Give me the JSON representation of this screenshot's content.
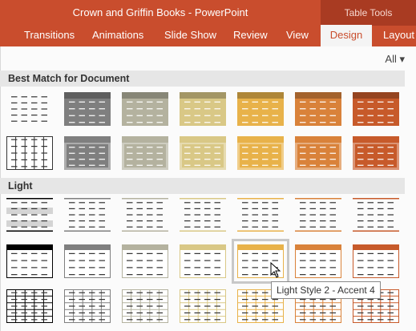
{
  "window": {
    "title": "Crown and Griffin Books - PowerPoint",
    "context_label": "Table Tools"
  },
  "tabs": [
    {
      "label": "Transitions"
    },
    {
      "label": "Animations"
    },
    {
      "label": "Slide Show"
    },
    {
      "label": "Review"
    },
    {
      "label": "View"
    },
    {
      "label": "Design",
      "active": true
    },
    {
      "label": "Layout"
    }
  ],
  "filter": {
    "label": "All ▾"
  },
  "sections": [
    {
      "label": "Best Match for Document"
    },
    {
      "label": "Light"
    }
  ],
  "tooltip": {
    "text": "Light Style 2 - Accent 4"
  },
  "colors": {
    "accent_title_bar": "#c94d2d",
    "accent_context": "#a93b22",
    "palette_best": [
      "#ffffff",
      "#7f7f7f",
      "#b4b29f",
      "#d9c886",
      "#e8b24a",
      "#d9823a",
      "#c75a2a"
    ],
    "palette_light": [
      "#000000",
      "#7f7f7f",
      "#b4b29f",
      "#d9c886",
      "#e8b24a",
      "#d9823a",
      "#c75a2a"
    ]
  }
}
